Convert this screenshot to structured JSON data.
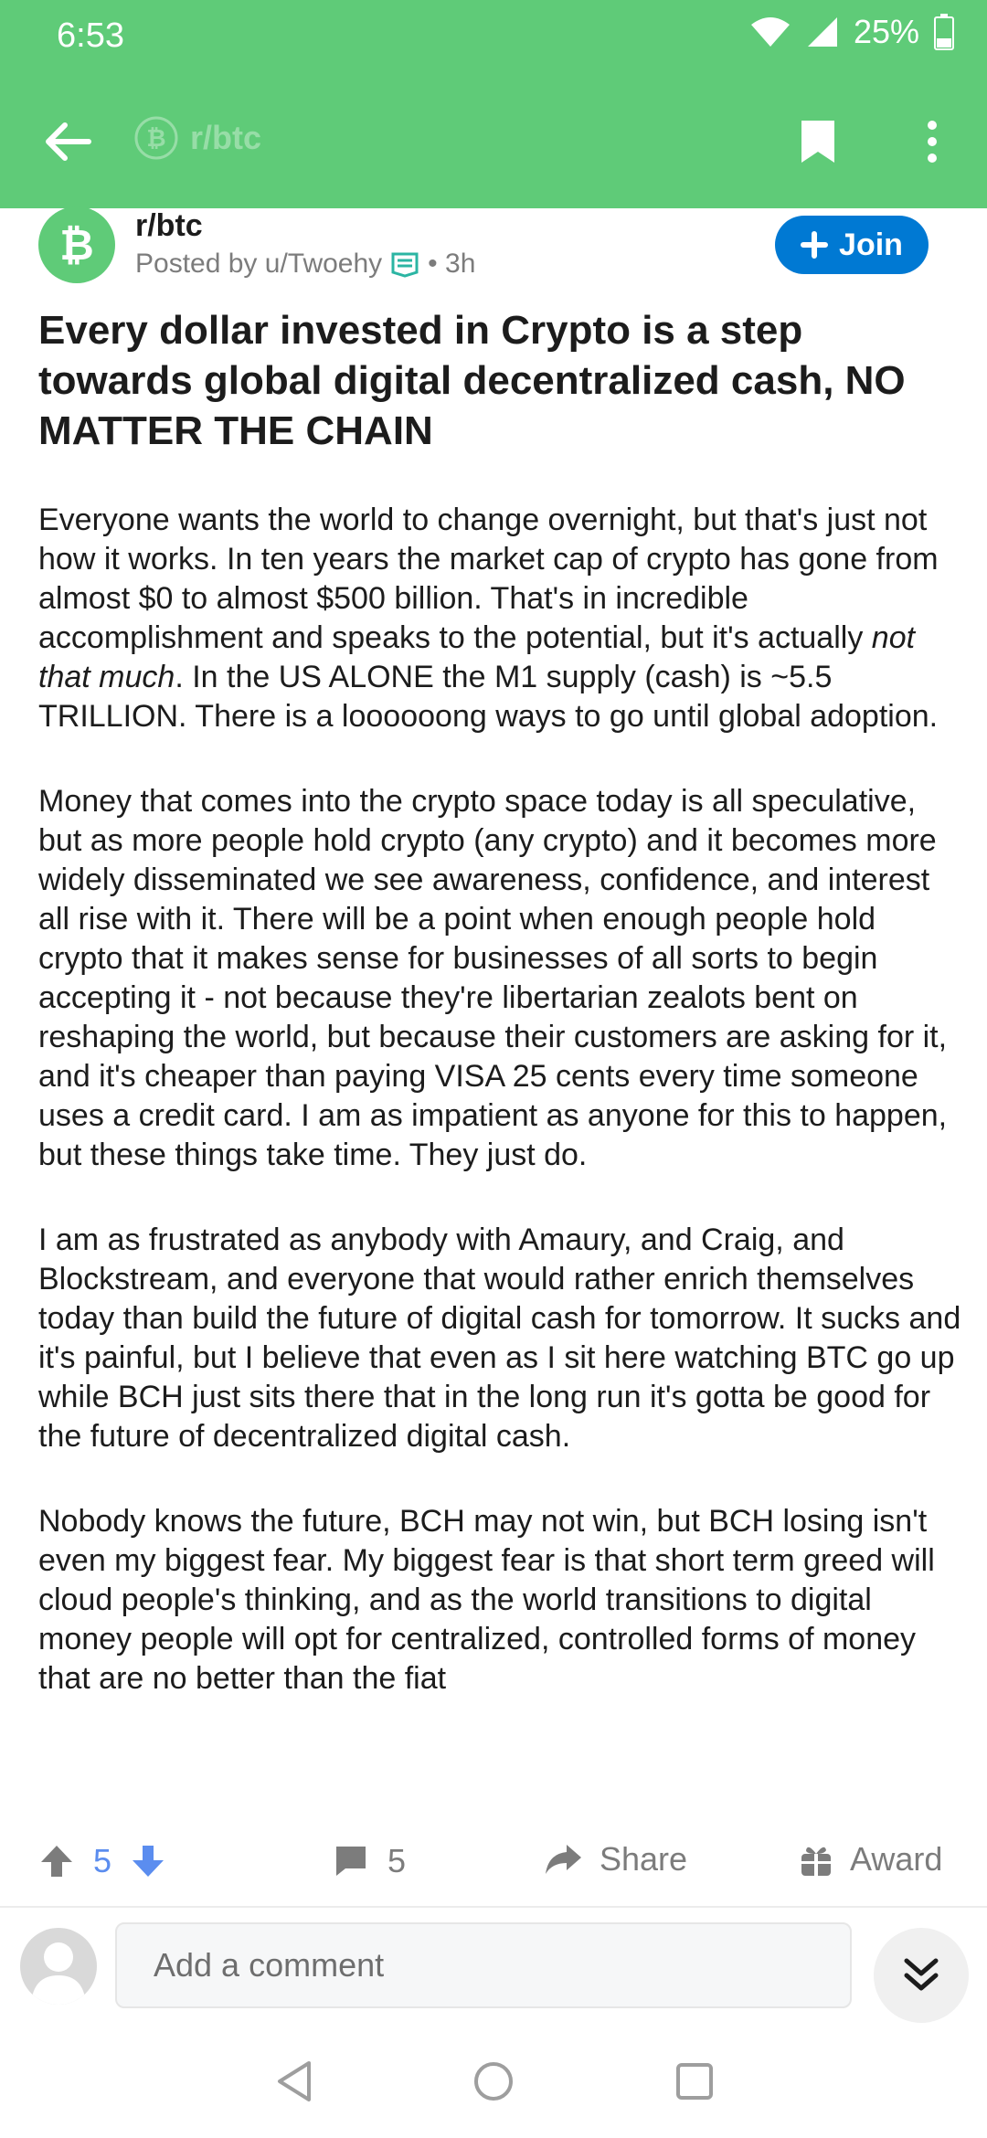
{
  "status_bar": {
    "time": "6:53",
    "battery": "25%"
  },
  "app_bar": {
    "subreddit_faded": "r/btc"
  },
  "post": {
    "subreddit": "r/btc",
    "posted_by": "Posted by u/Twoehy",
    "age": "• 3h",
    "join_label": "Join",
    "title": "Every dollar invested in Crypto is a step towards global digital decentralized cash, NO MATTER THE CHAIN",
    "body": {
      "p1_a": "Everyone wants the world to change overnight, but that's just not how it works. In ten years the market cap of crypto has gone from almost $0 to almost $500 billion. That's in incredible accomplishment and speaks to the potential, but it's actually ",
      "p1_em": "not that much",
      "p1_b": ". In the US ALONE the M1 supply (cash) is ~5.5 TRILLION. There is a loooooong ways to go until global adoption.",
      "p2": "Money that comes into the crypto space today is all speculative, but as more people hold crypto (any crypto) and it becomes more widely disseminated we see awareness, confidence, and interest all rise with it. There will be a point when enough people hold crypto that it makes sense for businesses of all sorts to begin accepting it - not because they're libertarian zealots bent on reshaping the world, but because their customers are asking for it, and it's cheaper than paying VISA 25 cents every time someone uses a credit card. I am as impatient as anyone for this to happen, but these things take time. They just do.",
      "p3": "I am as frustrated as anybody with Amaury, and Craig, and Blockstream, and everyone that would rather enrich themselves today than build the future of digital cash for tomorrow. It sucks and it's painful, but I believe that even as I sit here watching BTC go up while BCH just sits there that in the long run it's gotta be good for the future of decentralized digital cash.",
      "p4": "Nobody knows the future, BCH may not win, but BCH losing isn't even my biggest fear. My biggest fear is that short term greed will cloud people's thinking, and as the world transitions to digital money people will opt for centralized, controlled forms of money that are no better than the fiat"
    },
    "votes": "5",
    "comments": "5",
    "share_label": "Share",
    "award_label": "Award"
  },
  "comment_bar": {
    "placeholder": "Add a comment"
  },
  "colors": {
    "header": "#5fcb78",
    "join": "#0079d3",
    "upvote": "#5b8def"
  },
  "icons": [
    "back-arrow-icon",
    "bitcoin-icon",
    "bookmark-icon",
    "kebab-icon",
    "upvote-icon",
    "downvote-icon",
    "comment-icon",
    "share-icon",
    "award-icon",
    "collapse-icon"
  ]
}
